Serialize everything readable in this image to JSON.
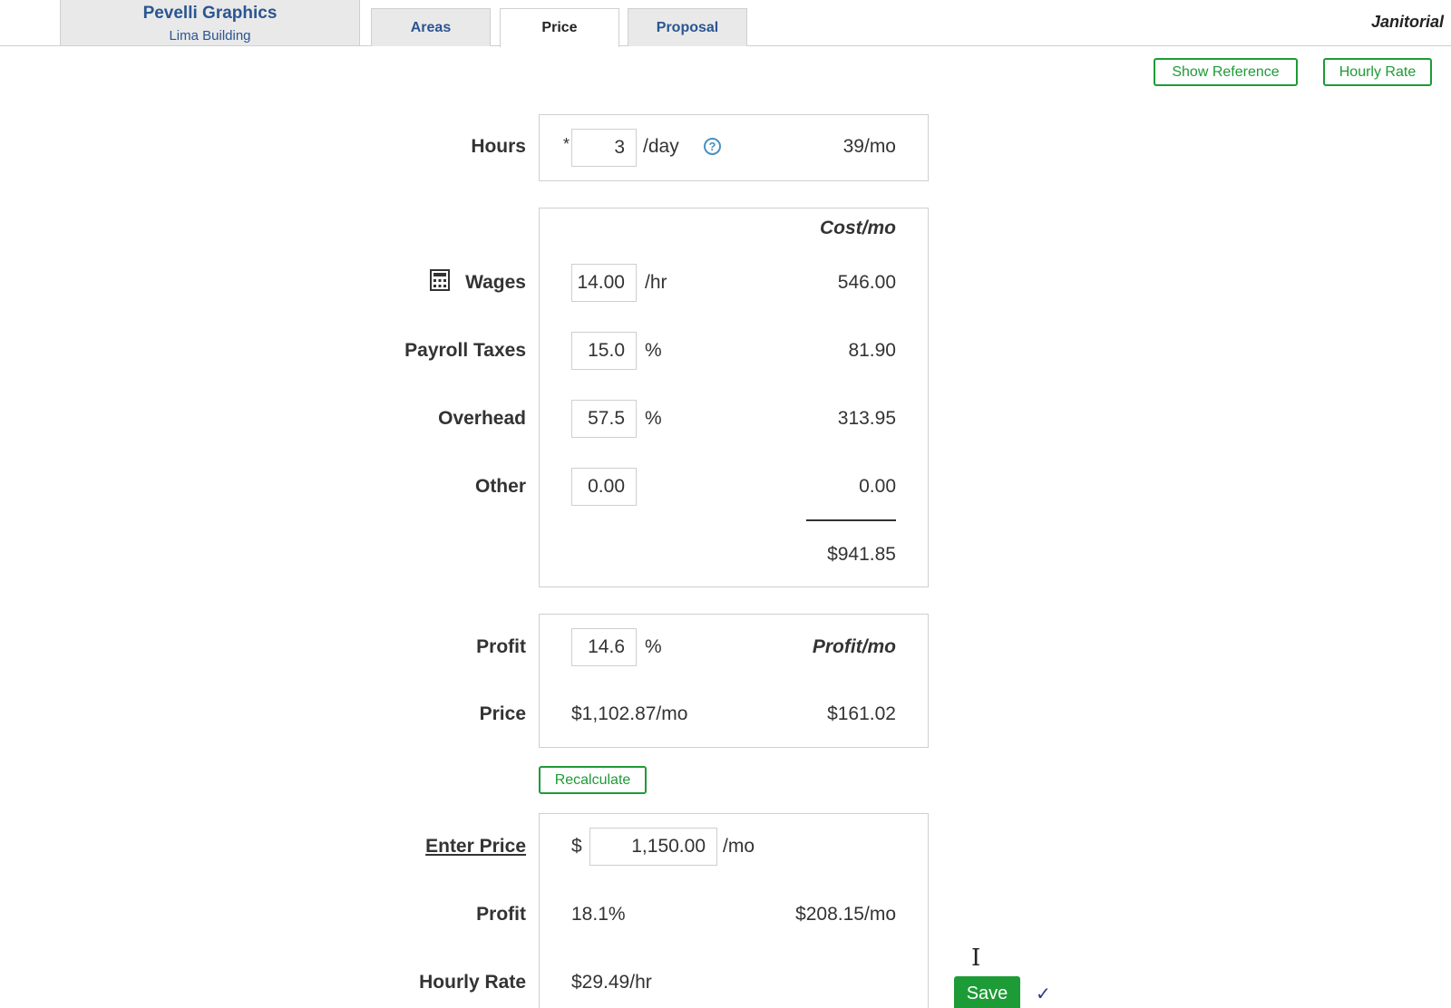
{
  "header": {
    "company_name": "Pevelli Graphics",
    "building": "Lima Building",
    "tabs": [
      {
        "label": "Areas",
        "active": false
      },
      {
        "label": "Price",
        "active": true
      },
      {
        "label": "Proposal",
        "active": false
      }
    ],
    "service": "Janitorial"
  },
  "toolbar": {
    "show_reference_label": "Show Reference",
    "hourly_rate_label": "Hourly Rate"
  },
  "hours": {
    "label": "Hours",
    "required_mark": "*",
    "value": "3",
    "unit": "/day",
    "help_icon": "?",
    "monthly": "39/mo"
  },
  "costs": {
    "header": "Cost/mo",
    "rows": [
      {
        "label": "Wages",
        "value": "14.00",
        "unit": "/hr",
        "cost": "546.00"
      },
      {
        "label": "Payroll Taxes",
        "value": "15.0",
        "unit": "%",
        "cost": "81.90"
      },
      {
        "label": "Overhead",
        "value": "57.5",
        "unit": "%",
        "cost": "313.95"
      },
      {
        "label": "Other",
        "value": "0.00",
        "unit": "",
        "cost": "0.00"
      }
    ],
    "total": "$941.85"
  },
  "profit": {
    "label": "Profit",
    "value": "14.6",
    "unit": "%",
    "header": "Profit/mo",
    "price_label": "Price",
    "price_value": "$1,102.87/mo",
    "profit_amount": "$161.02"
  },
  "recalculate_label": "Recalculate",
  "enter_price": {
    "label": "Enter Price",
    "currency": "$",
    "value": "1,150.00",
    "unit": "/mo",
    "profit_label": "Profit",
    "profit_percent": "18.1%",
    "profit_amount": "$208.15/mo",
    "hourly_rate_label": "Hourly Rate",
    "hourly_rate_value": "$29.49/hr"
  },
  "save_label": "Save",
  "saved_mark": "✓",
  "colors": {
    "accent_green": "#1d9b36",
    "link_blue": "#2b5591",
    "border_gray": "#cfcfcf"
  }
}
